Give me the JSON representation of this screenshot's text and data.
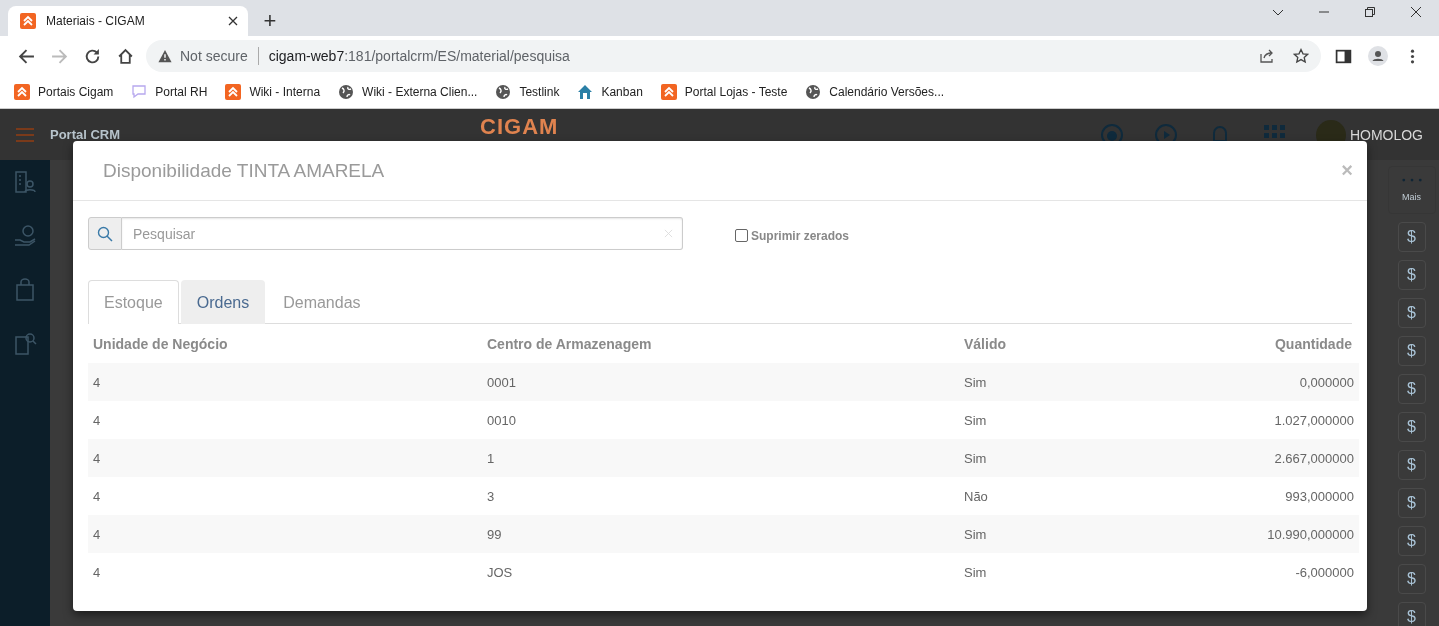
{
  "browser": {
    "tab_title": "Materiais - CIGAM",
    "new_tab": "+",
    "security": "Not secure",
    "url_host": "cigam-web7",
    "url_rest": ":181/portalcrm/ES/material/pesquisa"
  },
  "bookmarks": [
    {
      "label": "Portais Cigam",
      "kind": "cigam"
    },
    {
      "label": "Portal RH",
      "kind": "chat"
    },
    {
      "label": "Wiki - Interna",
      "kind": "cigam"
    },
    {
      "label": "Wiki - Externa Clien...",
      "kind": "globe"
    },
    {
      "label": "Testlink",
      "kind": "globe"
    },
    {
      "label": "Kanban",
      "kind": "kanban"
    },
    {
      "label": "Portal Lojas - Teste",
      "kind": "cigam"
    },
    {
      "label": "Calendário Versões...",
      "kind": "globe"
    }
  ],
  "app_header": {
    "title": "Portal CRM",
    "logo": "CIGAM",
    "user": "HOMOLOG"
  },
  "right_rail": {
    "more_label": "Mais",
    "price_buttons": [
      "$",
      "$",
      "$",
      "$",
      "$",
      "$",
      "$",
      "$",
      "$",
      "$",
      "$"
    ]
  },
  "dialog": {
    "title": "Disponibilidade TINTA AMARELA",
    "close": "×",
    "search": {
      "placeholder": "Pesquisar"
    },
    "suppress_zeros": {
      "label": "Suprimir zerados",
      "checked": false
    },
    "tabs": [
      {
        "label": "Estoque",
        "selected": true,
        "hovered": false
      },
      {
        "label": "Ordens",
        "selected": false,
        "hovered": true
      },
      {
        "label": "Demandas",
        "selected": false,
        "hovered": false
      }
    ],
    "table": {
      "columns": [
        "Unidade de Negócio",
        "Centro de Armazenagem",
        "Válido",
        "Quantidade"
      ],
      "rows": [
        [
          "4",
          "0001",
          "Sim",
          "0,000000"
        ],
        [
          "4",
          "0010",
          "Sim",
          "1.027,000000"
        ],
        [
          "4",
          "1",
          "Sim",
          "2.667,000000"
        ],
        [
          "4",
          "3",
          "Não",
          "993,000000"
        ],
        [
          "4",
          "99",
          "Sim",
          "10.990,000000"
        ],
        [
          "4",
          "JOS",
          "Sim",
          "-6,000000"
        ]
      ]
    }
  }
}
